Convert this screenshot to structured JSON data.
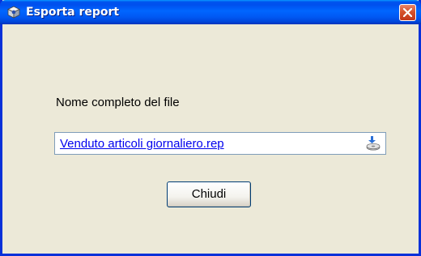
{
  "window": {
    "title": "Esporta report",
    "title_icon": "cube-icon",
    "close_icon": "close-icon",
    "titlebar_color": "#0058f3",
    "close_color": "#d5522c"
  },
  "form": {
    "label": "Nome completo del file",
    "file_name": "Venduto articoli giornaliero.rep",
    "save_icon": "save-disk-icon",
    "close_button_label": "Chiudi"
  }
}
